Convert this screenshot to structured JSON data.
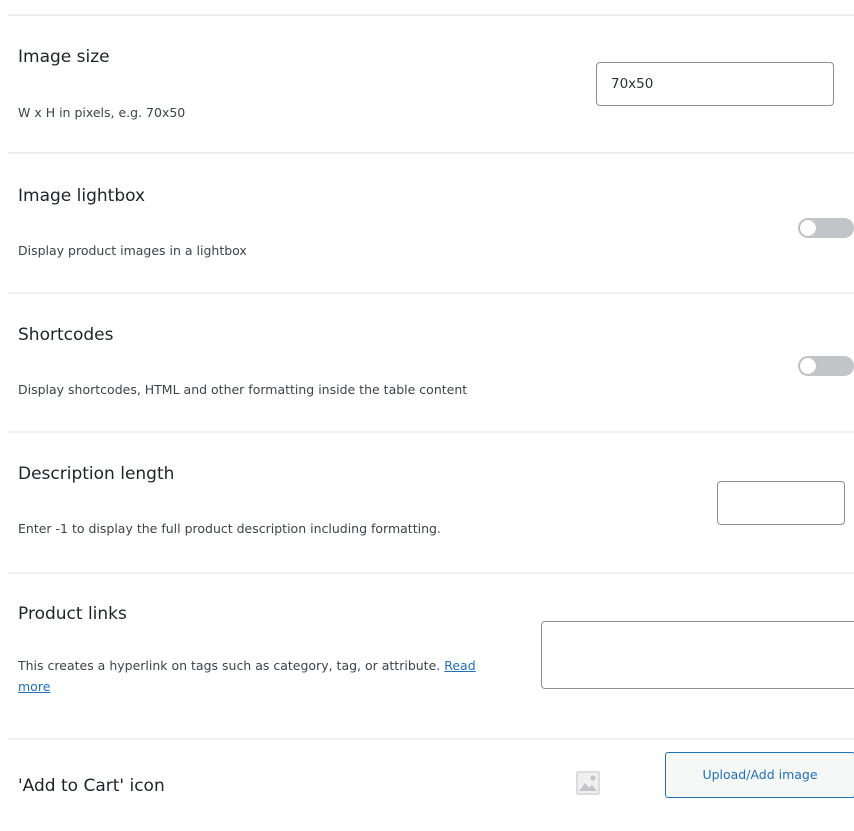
{
  "settings": {
    "image_size": {
      "label": "Image size",
      "description": "W x H in pixels, e.g. 70x50",
      "value": "70x50"
    },
    "image_lightbox": {
      "label": "Image lightbox",
      "description": "Display product images in a lightbox",
      "enabled": false
    },
    "shortcodes": {
      "label": "Shortcodes",
      "description": "Display shortcodes, HTML and other formatting inside the table content",
      "enabled": false
    },
    "description_length": {
      "label": "Description length",
      "description": "Enter -1 to display the full product description including formatting.",
      "value": ""
    },
    "product_links": {
      "label": "Product links",
      "description": "This creates a hyperlink on tags such as category, tag, or attribute.",
      "link_label": "Read more",
      "value": ""
    },
    "add_to_cart_icon": {
      "label": "'Add to Cart' icon",
      "button_label": "Upload/Add image",
      "icon": "image-placeholder-icon"
    }
  },
  "colors": {
    "accent": "#2271b1",
    "toggle_off": "#c3c4c7",
    "divider": "#f0f0f1",
    "input_border": "#8c8f94"
  }
}
